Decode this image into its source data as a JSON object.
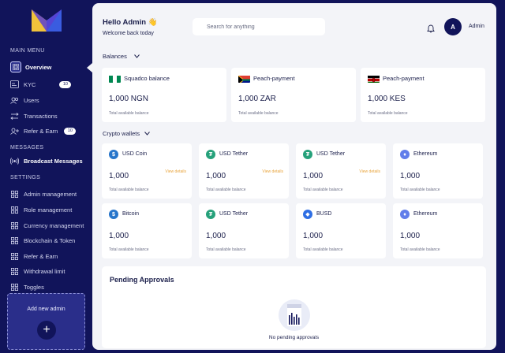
{
  "sidebar": {
    "sections": {
      "main_menu": "MAIN MENU",
      "messages": "MESSAGES",
      "settings": "SETTINGS"
    },
    "main_items": [
      {
        "label": "Overview",
        "icon": "grid-icon"
      },
      {
        "label": "KYC",
        "icon": "id-card-icon",
        "badge": "10"
      },
      {
        "label": "Users",
        "icon": "users-icon"
      },
      {
        "label": "Transactions",
        "icon": "transactions-icon"
      },
      {
        "label": "Refer & Earn",
        "icon": "refer-icon",
        "badge": "10"
      }
    ],
    "message_items": [
      {
        "label": "Broadcast Messages",
        "icon": "broadcast-icon"
      }
    ],
    "settings_items": [
      {
        "label": "Admin management",
        "icon": "grid-icon"
      },
      {
        "label": "Role management",
        "icon": "grid-icon"
      },
      {
        "label": "Currency management",
        "icon": "grid-icon"
      },
      {
        "label": "Blockchain & Token",
        "icon": "grid-icon"
      },
      {
        "label": "Refer & Earn",
        "icon": "grid-icon"
      },
      {
        "label": "Withdrawal limit",
        "icon": "grid-icon"
      },
      {
        "label": "Toggles",
        "icon": "grid-icon"
      }
    ],
    "add_admin": {
      "label": "Add new admin",
      "icon": "plus-icon"
    }
  },
  "header": {
    "greeting": "Hello Admin",
    "greeting_emoji": "👋",
    "subtitle": "Welcome back today",
    "search_placeholder": "Search for anything",
    "avatar_initial": "A",
    "user_name": "Admin"
  },
  "balances": {
    "title": "Balances",
    "items": [
      {
        "name": "Squadco balance",
        "amount": "1,000 NGN",
        "sub": "Total available balance",
        "flag": "nigeria-flag-icon"
      },
      {
        "name": "Peach-payment",
        "amount": "1,000 ZAR",
        "sub": "Total available balance",
        "flag": "south-africa-flag-icon"
      },
      {
        "name": "Peach-payment",
        "amount": "1,000 KES",
        "sub": "Total available balance",
        "flag": "kenya-flag-icon"
      }
    ]
  },
  "crypto": {
    "title": "Crypto wallets",
    "items": [
      {
        "name": "USD Coin",
        "amount": "1,000",
        "sub": "Total available balance",
        "view": "View details",
        "icon": "usd-coin-icon",
        "color": "#2775ca"
      },
      {
        "name": "USD Tether",
        "amount": "1,000",
        "sub": "Total available balance",
        "view": "View details",
        "icon": "tether-icon",
        "color": "#26a17b"
      },
      {
        "name": "USD Tether",
        "amount": "1,000",
        "sub": "Total available balance",
        "view": "View details",
        "icon": "tether-icon",
        "color": "#26a17b"
      },
      {
        "name": "Ethereum",
        "amount": "1,000",
        "sub": "Total available balance",
        "view": "",
        "icon": "ethereum-icon",
        "color": "#627eea"
      },
      {
        "name": "Bitcoin",
        "amount": "1,000",
        "sub": "Total available balance",
        "view": "",
        "icon": "usd-coin-icon",
        "color": "#2775ca"
      },
      {
        "name": "USD Tether",
        "amount": "1,000",
        "sub": "Total available balance",
        "view": "",
        "icon": "tether-icon",
        "color": "#26a17b"
      },
      {
        "name": "BUSD",
        "amount": "1,000",
        "sub": "Total available balance",
        "view": "",
        "icon": "busd-icon",
        "color": "#2f6fe4"
      },
      {
        "name": "Ethereum",
        "amount": "1,000",
        "sub": "Total available balance",
        "view": "",
        "icon": "ethereum-icon",
        "color": "#627eea"
      }
    ]
  },
  "pending": {
    "title": "Pending Approvals",
    "empty_text": "No pending approvals",
    "icon": "empty-chart-icon"
  },
  "colors": {
    "sidebar_bg": "#11145a",
    "main_bg": "#f3f4f8",
    "accent_orange": "#e8a33a"
  }
}
